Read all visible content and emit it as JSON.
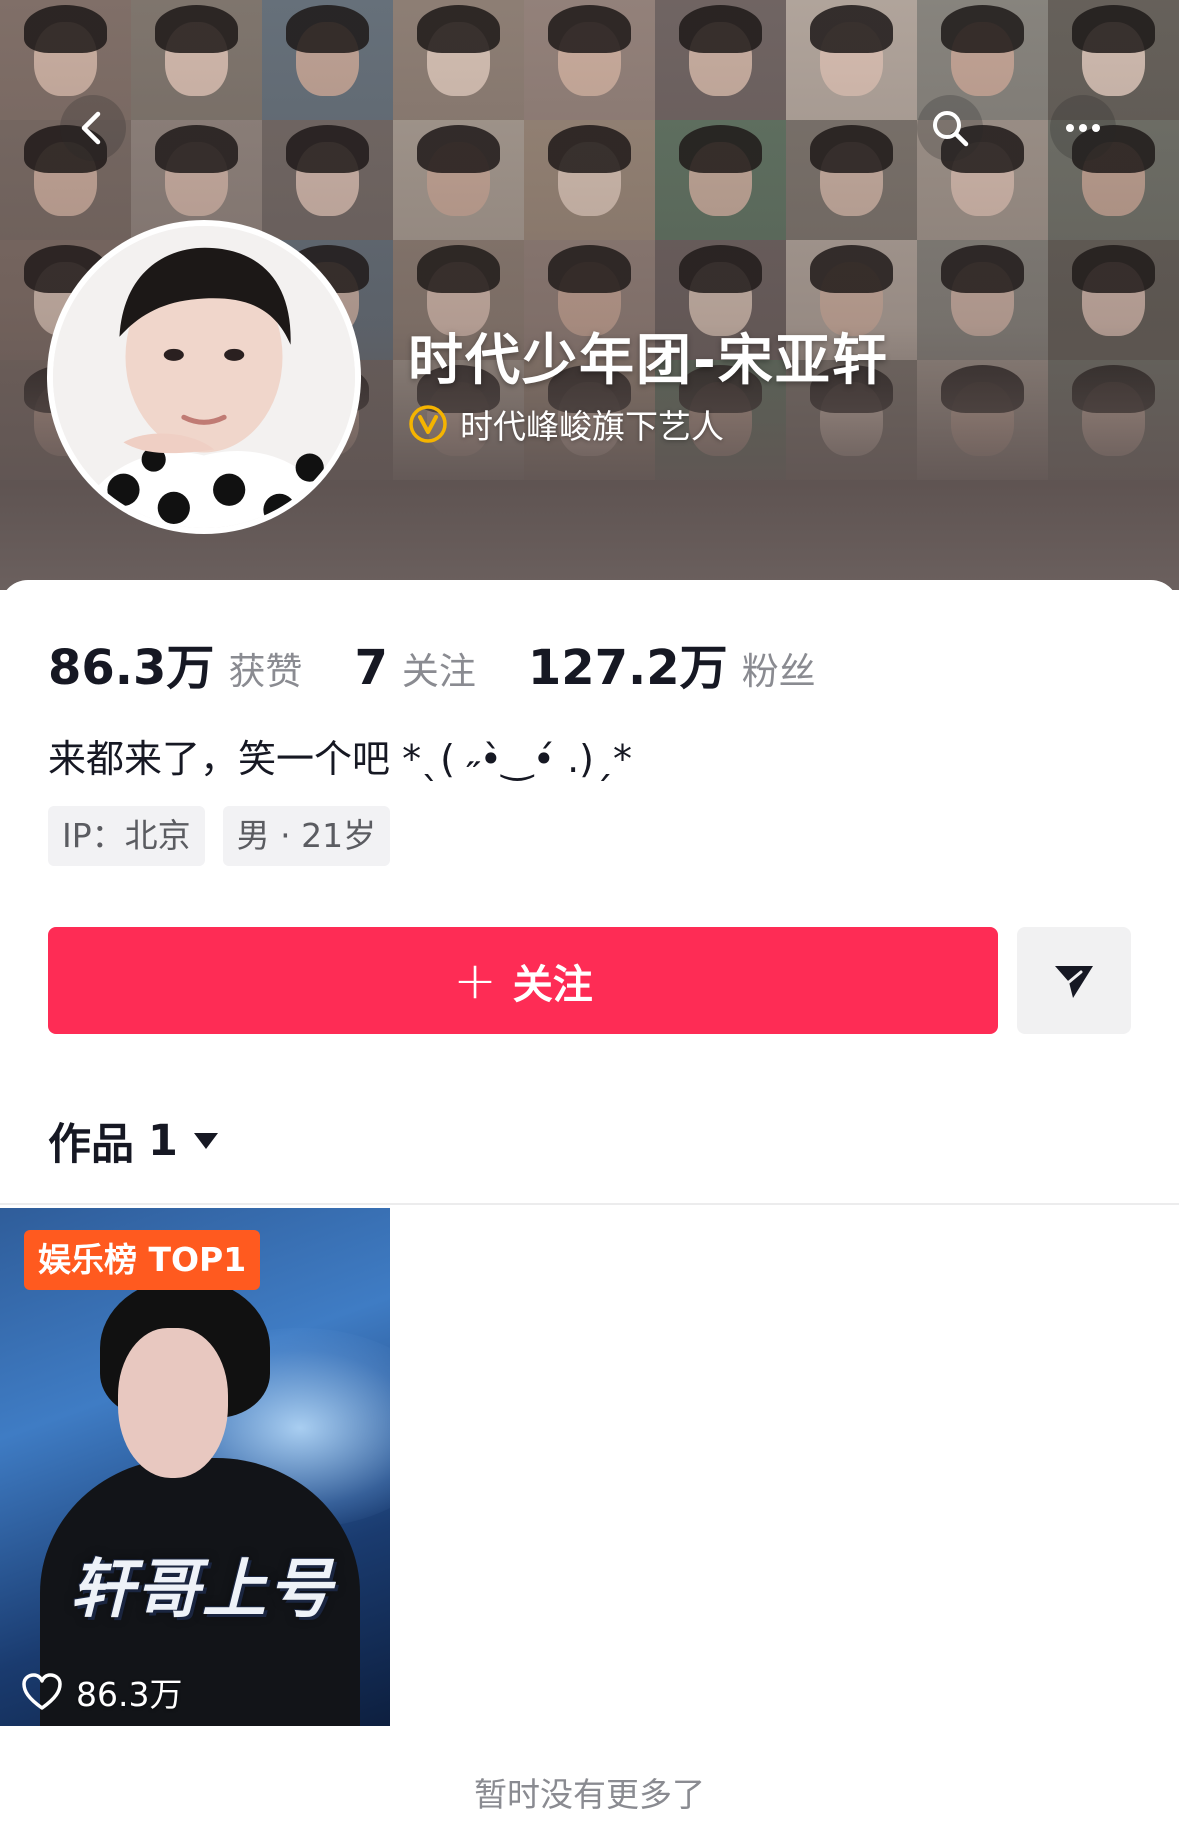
{
  "header": {
    "profile_name": "时代少年团-宋亚轩",
    "verification_text": "时代峰峻旗下艺人",
    "icons": [
      "back-icon",
      "search-icon",
      "more-icon",
      "verified-icon"
    ]
  },
  "stats": {
    "likes_value": "86.3万",
    "likes_label": "获赞",
    "following_value": "7",
    "following_label": "关注",
    "followers_value": "127.2万",
    "followers_label": "粉丝"
  },
  "bio": "来都来了，笑一个吧 *ˎ( ˶•̀‿•́ .)ˏ*",
  "tags": [
    "IP：北京",
    "男 · 21岁"
  ],
  "actions": {
    "follow_plus": "+",
    "follow_label": "关注",
    "share_icon": "send-icon"
  },
  "works": {
    "label": "作品",
    "count": "1"
  },
  "videos": [
    {
      "badge": "娱乐榜 TOP1",
      "cover_title": "轩哥上号",
      "likes": "86.3万"
    }
  ],
  "footer": {
    "end_text": "暂时没有更多了"
  },
  "colors": {
    "accent": "#fe2c55",
    "badge": "#ff5a1f",
    "text_primary": "#161823",
    "text_secondary": "#8a8b91"
  }
}
